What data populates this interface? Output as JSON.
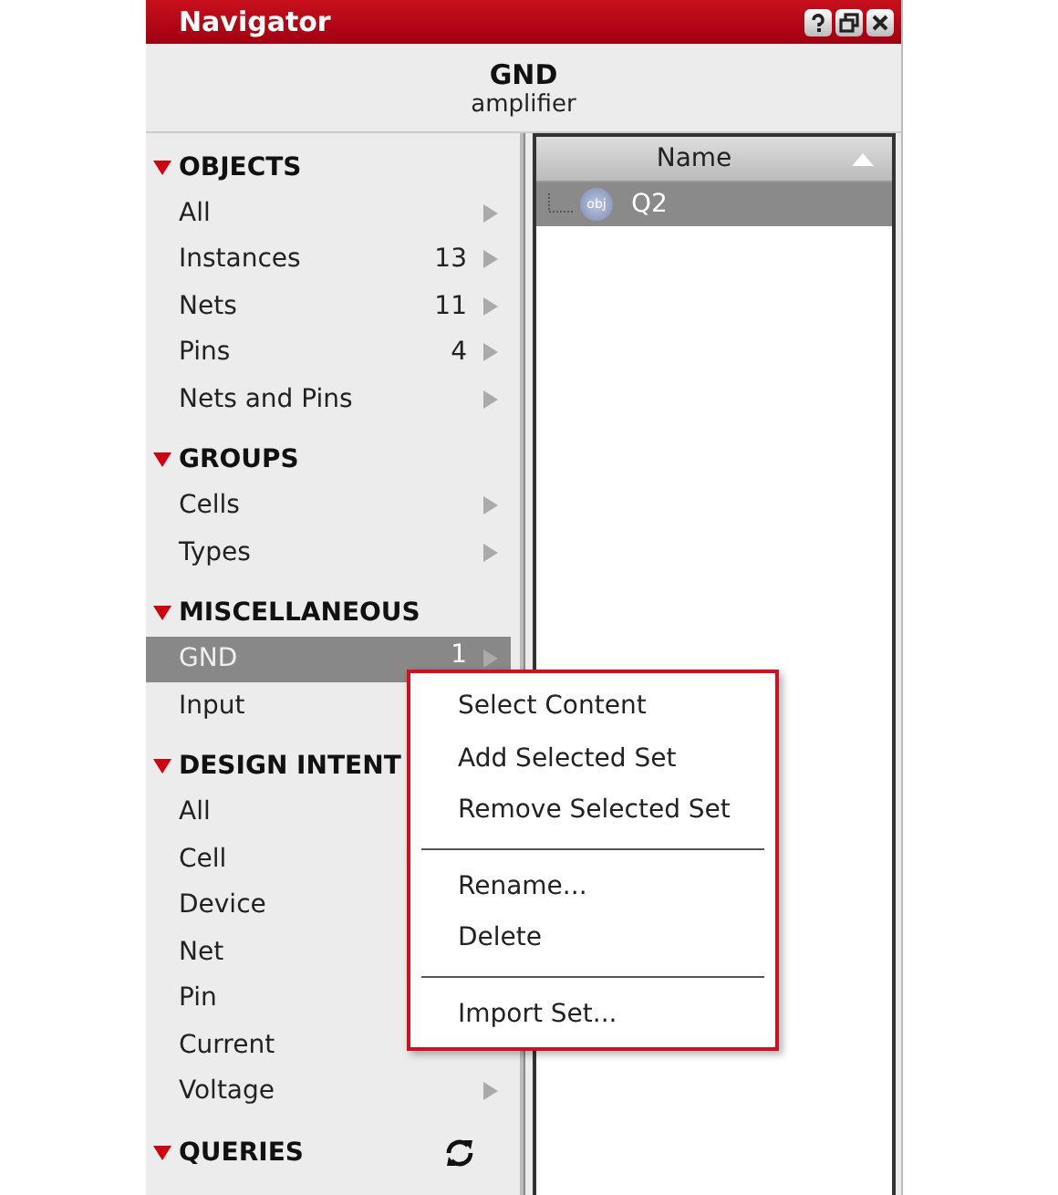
{
  "window": {
    "title": "Navigator"
  },
  "header": {
    "title": "GND",
    "subtitle": "amplifier"
  },
  "sections": [
    {
      "label": "OBJECTS",
      "expanded": true,
      "items": [
        {
          "label": "All",
          "arrow": true,
          "selected": false
        },
        {
          "label": "Instances",
          "count": "13",
          "arrow": true,
          "selected": false
        },
        {
          "label": "Nets",
          "count": "11",
          "arrow": true,
          "selected": false
        },
        {
          "label": "Pins",
          "count": "4",
          "arrow": true,
          "selected": false
        },
        {
          "label": "Nets and Pins",
          "arrow": true,
          "selected": false
        }
      ]
    },
    {
      "label": "GROUPS",
      "expanded": true,
      "items": [
        {
          "label": "Cells",
          "arrow": true,
          "selected": false
        },
        {
          "label": "Types",
          "arrow": true,
          "selected": false
        }
      ]
    },
    {
      "label": "MISCELLANEOUS",
      "expanded": true,
      "items": [
        {
          "label": "GND",
          "count": "1",
          "arrow": true,
          "selected": true
        },
        {
          "label": "Input",
          "arrow": false,
          "selected": false
        }
      ]
    },
    {
      "label": "DESIGN INTENT",
      "expanded": true,
      "items": [
        {
          "label": "All",
          "arrow": false,
          "selected": false
        },
        {
          "label": "Cell",
          "arrow": false,
          "selected": false
        },
        {
          "label": "Device",
          "arrow": false,
          "selected": false
        },
        {
          "label": "Net",
          "arrow": false,
          "selected": false
        },
        {
          "label": "Pin",
          "arrow": false,
          "selected": false
        },
        {
          "label": "Current",
          "arrow": false,
          "selected": false
        },
        {
          "label": "Voltage",
          "arrow": true,
          "selected": false
        }
      ]
    },
    {
      "label": "QUERIES",
      "expanded": true,
      "refresh": true
    }
  ],
  "table": {
    "columns": [
      {
        "label": "Name",
        "sorted": true
      }
    ],
    "rows": [
      {
        "name": "Q2",
        "badge": "obj",
        "selected": true
      }
    ]
  },
  "context_menu": {
    "items": [
      {
        "kind": "item",
        "label": "Select Content"
      },
      {
        "kind": "item",
        "label": "Add Selected Set"
      },
      {
        "kind": "item",
        "label": "Remove Selected Set"
      },
      {
        "kind": "separator"
      },
      {
        "kind": "item",
        "label": "Rename..."
      },
      {
        "kind": "item",
        "label": "Delete"
      },
      {
        "kind": "separator"
      },
      {
        "kind": "item",
        "label": "Import Set..."
      }
    ]
  }
}
